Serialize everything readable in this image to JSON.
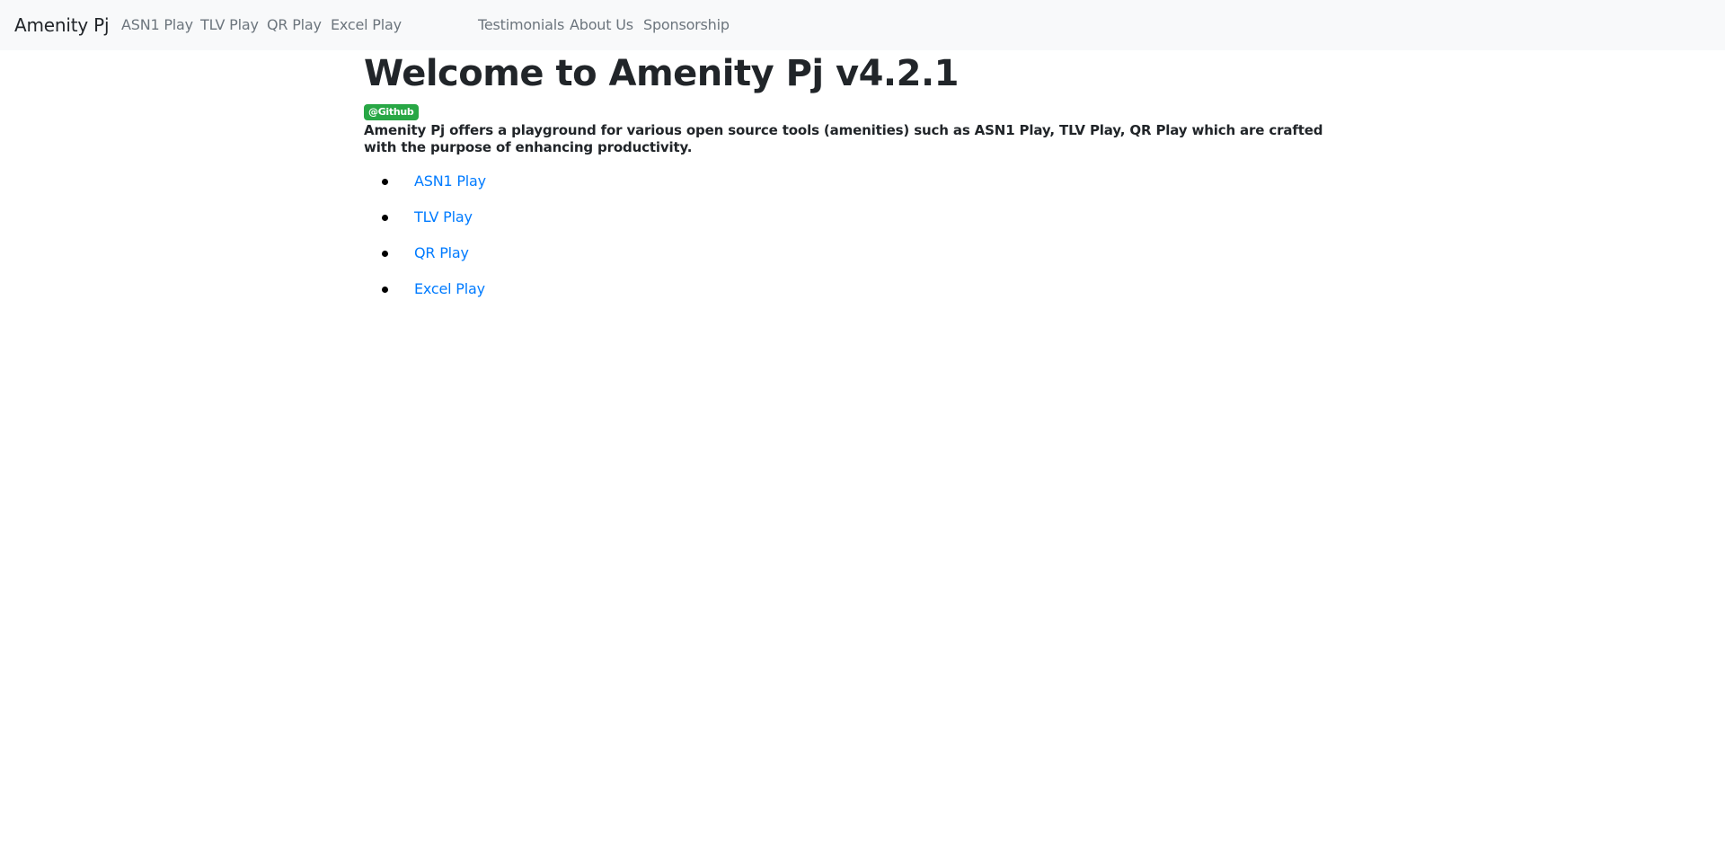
{
  "navbar": {
    "brand": "Amenity Pj",
    "links": [
      {
        "label": "ASN1 Play"
      },
      {
        "label": "TLV Play"
      },
      {
        "label": "QR Play"
      },
      {
        "label": "Excel Play"
      },
      {
        "label": "Testimonials"
      },
      {
        "label": "About Us"
      },
      {
        "label": "Sponsorship"
      }
    ]
  },
  "main": {
    "title": "Welcome to Amenity Pj v4.2.1",
    "badge": "@Github",
    "description": "Amenity Pj offers a playground for various open source tools (amenities) such as ASN1 Play, TLV Play, QR Play which are crafted with the purpose of enhancing productivity.",
    "tools": [
      {
        "label": "ASN1 Play"
      },
      {
        "label": "TLV Play"
      },
      {
        "label": "QR Play"
      },
      {
        "label": "Excel Play"
      }
    ]
  },
  "colors": {
    "navbar_bg": "#f8f9fa",
    "nav_link": "#6c757d",
    "link": "#007bff",
    "badge_bg": "#28a745",
    "text": "#212529"
  }
}
